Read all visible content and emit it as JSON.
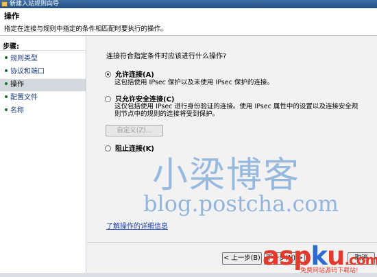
{
  "window": {
    "title": "新建入站规则向导"
  },
  "header": {
    "title": "操作",
    "description": "指定在连接与规则中指定的条件相匹配时要执行的操作。"
  },
  "sidebar": {
    "steps_label": "步骤:",
    "items": [
      {
        "label": "规则类型",
        "active": false
      },
      {
        "label": "协议和端口",
        "active": false
      },
      {
        "label": "操作",
        "active": true
      },
      {
        "label": "配置文件",
        "active": false
      },
      {
        "label": "名称",
        "active": false
      }
    ]
  },
  "main": {
    "question": "连接符合指定条件时应该进行什么操作?",
    "options": [
      {
        "label": "允许连接(A)",
        "selected": true,
        "description": "这包括使用 IPsec 保护以及未使用 IPsec 保护的连接。"
      },
      {
        "label": "只允许安全连接(C)",
        "selected": false,
        "description": "这仅包括使用 IPsec 进行身份验证的连接。使用 IPsec 属性中的设置以及连接安全规则节点中的规则的连接将受到保护。"
      },
      {
        "label": "阻止连接(K)",
        "selected": false
      }
    ],
    "custom_button": "自定义(Z)...",
    "learn_more": "了解操作的详细信息"
  },
  "buttons": {
    "back": "< 上一步(B)",
    "next": "下一步(N) >",
    "cancel": "取消"
  },
  "watermark": {
    "text_cn": "小梁博客",
    "url": "blog.postcha.com"
  },
  "logo": {
    "part1": "asp",
    "part2": "k",
    "part3": "u",
    "dot": ".",
    "part4": "com",
    "subtitle": "免费网站源码下载站!"
  }
}
